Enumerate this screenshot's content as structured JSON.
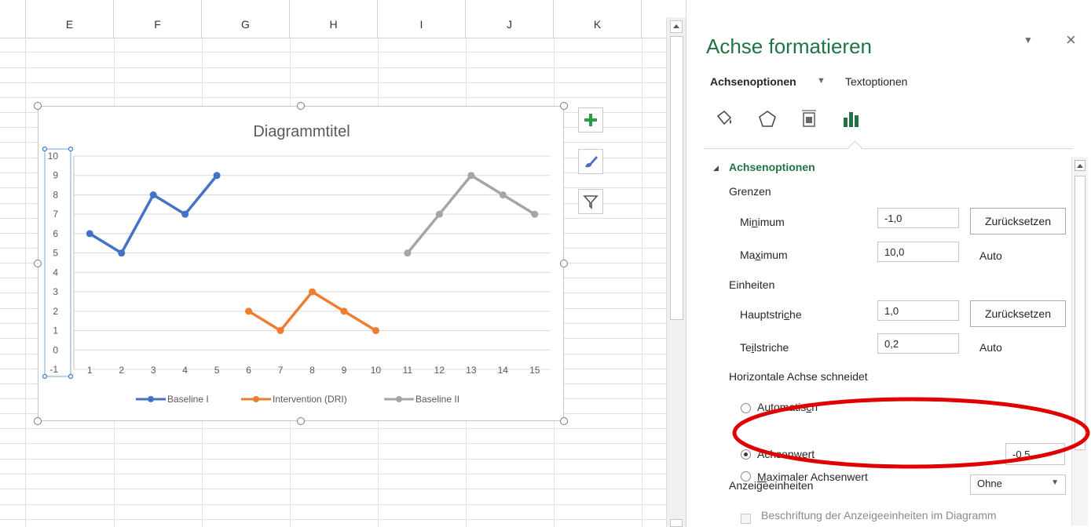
{
  "sheet": {
    "columns": [
      "E",
      "F",
      "G",
      "H",
      "I",
      "J",
      "K"
    ]
  },
  "chart_data": {
    "type": "line",
    "title": "Diagrammtitel",
    "xlabel": "",
    "ylabel": "",
    "x_ticks": [
      "1",
      "2",
      "3",
      "4",
      "5",
      "6",
      "7",
      "8",
      "9",
      "10",
      "11",
      "12",
      "13",
      "14",
      "15"
    ],
    "y_ticks": [
      "-1",
      "0",
      "1",
      "2",
      "3",
      "4",
      "5",
      "6",
      "7",
      "8",
      "9",
      "10"
    ],
    "ylim": [
      -1,
      10
    ],
    "grid": true,
    "legend_position": "bottom",
    "series": [
      {
        "name": "Baseline I",
        "color": "#4472c4",
        "x": [
          1,
          2,
          3,
          4,
          5
        ],
        "values": [
          6,
          5,
          8,
          7,
          9
        ]
      },
      {
        "name": "Intervention (DRI)",
        "color": "#ed7d31",
        "x": [
          6,
          7,
          8,
          9,
          10
        ],
        "values": [
          2,
          1,
          3,
          2,
          1
        ]
      },
      {
        "name": "Baseline II",
        "color": "#a5a5a5",
        "x": [
          11,
          12,
          13,
          14,
          15
        ],
        "values": [
          5,
          7,
          9,
          8,
          7
        ]
      }
    ]
  },
  "chart_buttons": [
    {
      "name": "chart-elements-button",
      "icon": "plus-icon"
    },
    {
      "name": "chart-styles-button",
      "icon": "brush-icon"
    },
    {
      "name": "chart-filters-button",
      "icon": "filter-icon"
    }
  ],
  "pane": {
    "title": "Achse formatieren",
    "dropdown_glyph": "▼",
    "close_glyph": "×",
    "tab_axis": "Achsenoptionen",
    "tab_text": "Textoptionen",
    "icons": [
      "fill-line-icon",
      "effects-icon",
      "size-properties-icon",
      "axis-options-icon"
    ],
    "section": "Achsenoptionen",
    "bounds_label": "Grenzen",
    "minimum_label": "Minimum",
    "minimum_value": "-1,0",
    "minimum_reset": "Zurücksetzen",
    "maximum_label": "Maximum",
    "maximum_value": "10,0",
    "maximum_auto": "Auto",
    "units_label": "Einheiten",
    "major_label": "Hauptstriche",
    "major_value": "1,0",
    "major_reset": "Zurücksetzen",
    "minor_label": "Teilstriche",
    "minor_value": "0,2",
    "minor_auto": "Auto",
    "crosses_label": "Horizontale Achse schneidet",
    "radio_auto": "Automatisch",
    "radio_value": "Achsenwert",
    "radio_value_input": "-0,5",
    "radio_max": "Maximaler Achsenwert",
    "display_units_label": "Anzeigeeinheiten",
    "display_units_value": "Ohne",
    "display_units_checkbox": "Beschriftung der Anzeigeeinheiten im Diagramm",
    "accent_color": "#217346",
    "annotation_color": "#e00000"
  }
}
